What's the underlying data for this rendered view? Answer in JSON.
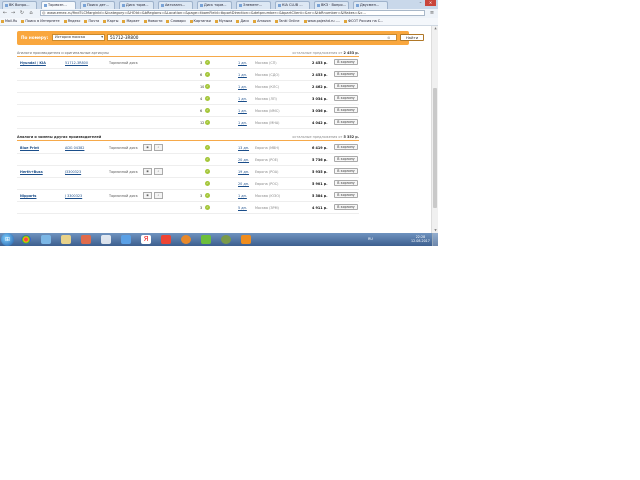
{
  "browser": {
    "tabs": [
      {
        "label": "ВК Вопро...",
        "active": false
      },
      {
        "label": "Тормозн...",
        "active": true
      },
      {
        "label": "Поиск дет...",
        "active": false
      },
      {
        "label": "Диск торм...",
        "active": false
      },
      {
        "label": "Автозапч...",
        "active": false
      },
      {
        "label": "Диск торм...",
        "active": false
      },
      {
        "label": "Элемент...",
        "active": false
      },
      {
        "label": "КIA CLUB ...",
        "active": false
      },
      {
        "label": "ВКЗ · Вопро...",
        "active": false
      },
      {
        "label": "Двусмен...",
        "active": false
      }
    ],
    "url": "www.emex.ru/find?LCMarginId=&lcategory=&HOId=&bRegions=&Location=&page=tbomField=tbportDirection=&detpnumber=&bpartClient=&nr=&tbRnumber=&Makes=&c...",
    "bookmarks": [
      "Mail.Ru",
      "Поиск в Интернете",
      "Яндекс",
      "Почта",
      "Карты",
      "Маркет",
      "Новости",
      "Словари",
      "Картинки",
      "Музыка",
      "Диск",
      "Amazon",
      "Tanki Online",
      "www.pajeshd.ru -...",
      "ФСОТ Россия на С..."
    ]
  },
  "search": {
    "label": "По номеру:",
    "select_value": "История поиска",
    "query": "51712-3R800",
    "button": "Найти"
  },
  "section1": {
    "title": "Аналоги производителя и оригинальные артикулы",
    "offers_label": "остальные предложения от",
    "offers_price": "2 453 р."
  },
  "section2": {
    "title": "Аналоги и замены других производителей",
    "offers_label": "остальные предложения от",
    "offers_price": "5 352 р."
  },
  "cart_label": "В корзину",
  "rows1": [
    {
      "brand": "Hyundai / KIA",
      "article": "51712-3R800",
      "name": "Тормозной диск",
      "qty": "3",
      "days": "1 дн.",
      "store": "Москва (СП)",
      "price": "2 453 р."
    },
    {
      "brand": "",
      "article": "",
      "name": "",
      "qty": "6",
      "days": "1 дн.",
      "store": "Москва (СДО)",
      "price": "2 453 р."
    },
    {
      "brand": "",
      "article": "",
      "name": "",
      "qty": "10",
      "days": "1 дн.",
      "store": "Москва (КЛС)",
      "price": "2 462 р."
    },
    {
      "brand": "",
      "article": "",
      "name": "",
      "qty": "4",
      "days": "1 дн.",
      "store": "Москва (ЛП)",
      "price": "3 034 р."
    },
    {
      "brand": "",
      "article": "",
      "name": "",
      "qty": "6",
      "days": "1 дн.",
      "store": "Москва (ИМС)",
      "price": "3 036 р."
    },
    {
      "brand": "",
      "article": "",
      "name": "",
      "qty": "12",
      "days": "1 дн.",
      "store": "Москва (МНА)",
      "price": "4 042 р."
    }
  ],
  "rows2": [
    {
      "brand": "Blue Print",
      "article": "ADG 04382",
      "name": "Тормозной диск",
      "tools": true,
      "qty": "",
      "days": "13 дн.",
      "store": "Европа (МВН)",
      "price": "6 419 р."
    },
    {
      "brand": "",
      "article": "",
      "name": "",
      "tools": false,
      "qty": "",
      "days": "20 дн.",
      "store": "Европа (РОЕ)",
      "price": "5 736 р."
    },
    {
      "brand": "Herth+Buss",
      "article": "J3300323",
      "name": "Тормозной диск",
      "tools": true,
      "qty": "",
      "days": "19 дн.",
      "store": "Европа (РОА)",
      "price": "5 935 р."
    },
    {
      "brand": "",
      "article": "",
      "name": "",
      "tools": false,
      "qty": "",
      "days": "20 дн.",
      "store": "Европа (РОС)",
      "price": "5 901 р."
    },
    {
      "brand": "Nipparts",
      "article": "J 3300323",
      "name": "Тормозной диск",
      "tools": true,
      "qty": "3",
      "days": "1 дн.",
      "store": "Москва (ЮЗО)",
      "price": "5 384 р."
    },
    {
      "brand": "",
      "article": "",
      "name": "",
      "tools": false,
      "qty": "3",
      "days": "5 дн.",
      "store": "Москва (ЗРМ)",
      "price": "4 911 р."
    }
  ],
  "taskbar": {
    "lang": "RU",
    "time": "22:28",
    "date": "12.08.2017"
  },
  "colors": {
    "accent": "#f9a73e",
    "taskbar": "#3d5f8f"
  }
}
